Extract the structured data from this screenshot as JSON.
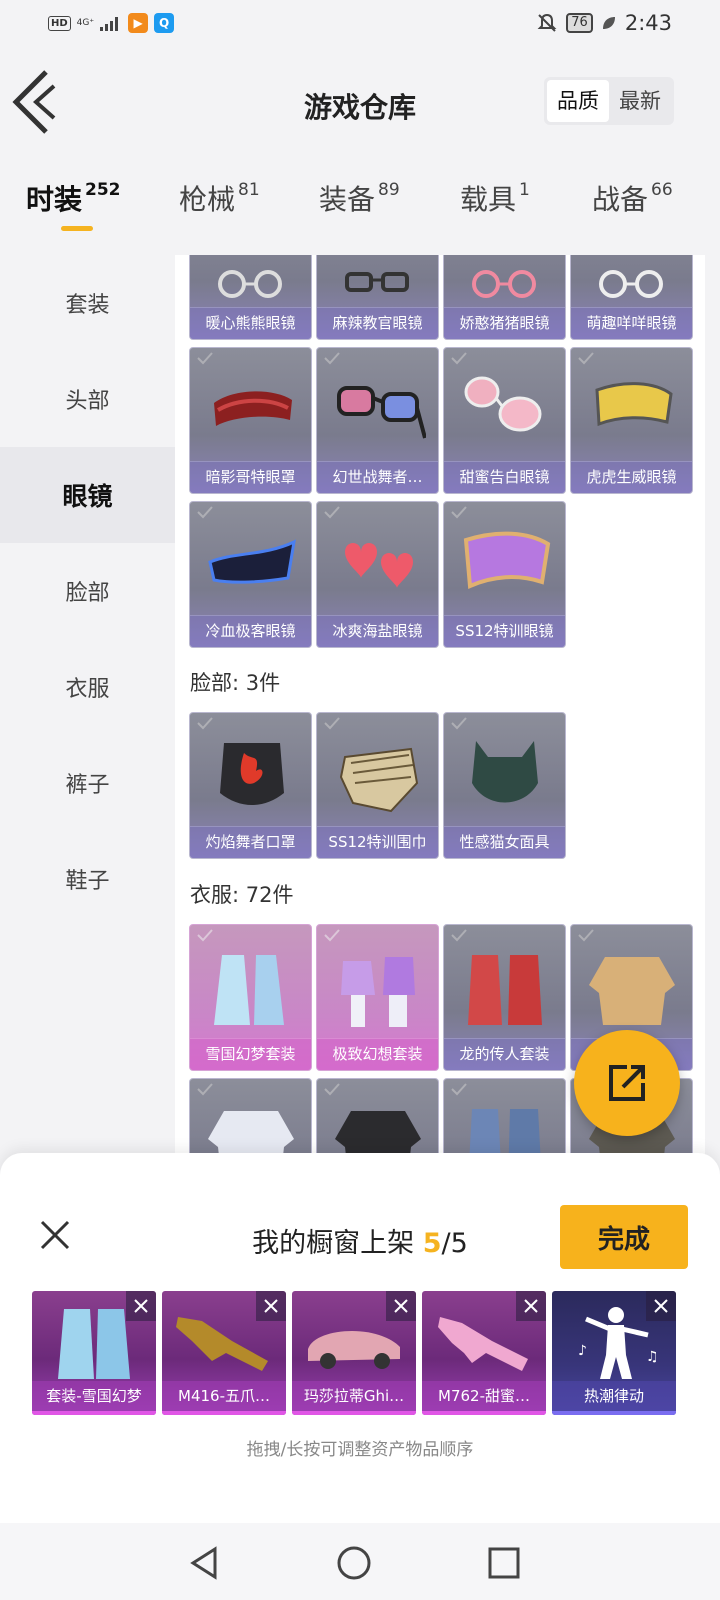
{
  "status_bar": {
    "hd": "HD",
    "network": "4G⁺",
    "battery": "76",
    "time": "2:43"
  },
  "header": {
    "title": "游戏仓库",
    "sort_options": [
      "品质",
      "最新"
    ],
    "sort_active": "品质"
  },
  "tabs": [
    {
      "label": "时装",
      "count": "252"
    },
    {
      "label": "枪械",
      "count": "81"
    },
    {
      "label": "装备",
      "count": "89"
    },
    {
      "label": "载具",
      "count": "1"
    },
    {
      "label": "战备",
      "count": "66"
    }
  ],
  "sidebar": {
    "items": [
      "套装",
      "头部",
      "眼镜",
      "脸部",
      "衣服",
      "裤子",
      "鞋子"
    ],
    "active": "眼镜"
  },
  "glasses_items": [
    "暖心熊熊眼镜",
    "麻辣教官眼镜",
    "娇憨猪猪眼镜",
    "萌趣咩咩眼镜",
    "暗影哥特眼罩",
    "幻世战舞者…",
    "甜蜜告白眼镜",
    "虎虎生威眼镜",
    "冷血极客眼镜",
    "冰爽海盐眼镜",
    "SS12特训眼镜"
  ],
  "face_section": {
    "title": "脸部: 3件",
    "items": [
      "灼焰舞者口罩",
      "SS12特训围巾",
      "性感猫女面具"
    ]
  },
  "clothes_section": {
    "title": "衣服: 72件",
    "items": [
      "雪国幻梦套装",
      "极致幻想套装",
      "龙的传人套装",
      "",
      "",
      "",
      "",
      ""
    ]
  },
  "showcase": {
    "title_prefix": "我的橱窗上架",
    "current": "5",
    "total": "/5",
    "done_label": "完成",
    "items": [
      "套装-雪国幻梦",
      "M416-五爪…",
      "玛莎拉蒂Ghi…",
      "M762-甜蜜…",
      "热潮律动"
    ],
    "hint": "拖拽/长按可调整资产物品顺序"
  },
  "colors": {
    "accent": "#f5b320",
    "card_purple": "#8b83b9",
    "card_pink": "#d678cf"
  }
}
